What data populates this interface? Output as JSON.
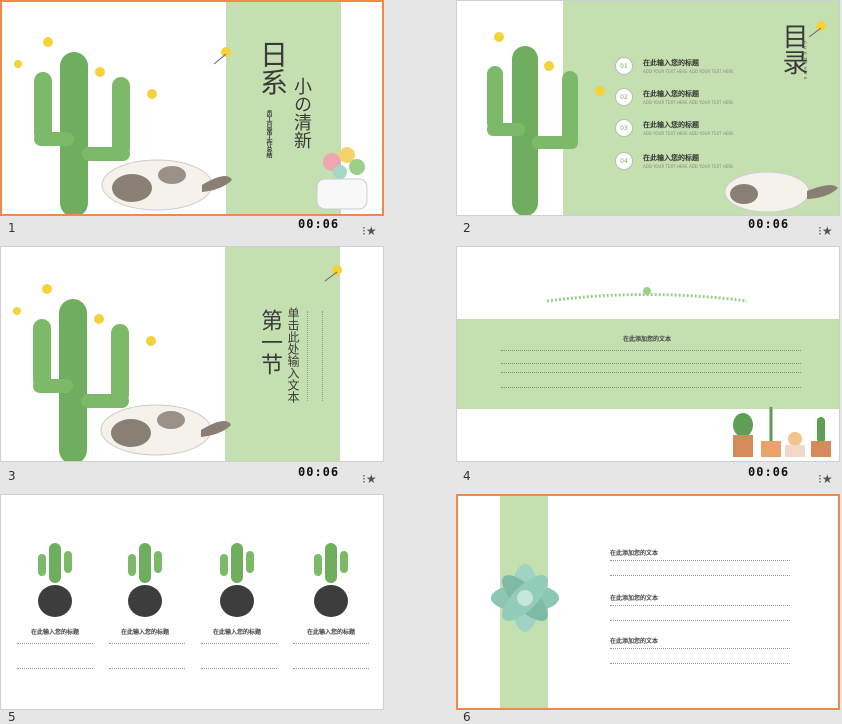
{
  "slides": [
    {
      "number": "1",
      "duration": "00:06",
      "title_a": "日系",
      "title_b": "小の清新",
      "subtitle": "员工日常工作总结"
    },
    {
      "number": "2",
      "duration": "00:06",
      "title": "目录",
      "contents": "CONTENTS",
      "items": [
        {
          "n": "01",
          "title": "在此输入您的标题",
          "sub": "ADD YOUR TEXT HERE  ADD YOUR TEXT HERE"
        },
        {
          "n": "02",
          "title": "在此输入您的标题",
          "sub": "ADD YOUR TEXT HERE  ADD YOUR TEXT HERE"
        },
        {
          "n": "03",
          "title": "在此输入您的标题",
          "sub": "ADD YOUR TEXT HERE  ADD YOUR TEXT HERE"
        },
        {
          "n": "04",
          "title": "在此输入您的标题",
          "sub": "ADD YOUR TEXT HERE  ADD YOUR TEXT HERE"
        }
      ]
    },
    {
      "number": "3",
      "duration": "00:06",
      "title": "第一节",
      "subtitle": "单击此处输入文本"
    },
    {
      "number": "4",
      "duration": "00:06",
      "heading": "在此添加您的文本"
    },
    {
      "number": "5",
      "captions": [
        "在此输入您的标题",
        "在此输入您的标题",
        "在此输入您的标题",
        "在此输入您的标题"
      ]
    },
    {
      "number": "6",
      "headings": [
        "在此添加您的文本",
        "在此添加您的文本",
        "在此添加您的文本"
      ]
    }
  ],
  "icons": {
    "transition": "star-icon"
  }
}
